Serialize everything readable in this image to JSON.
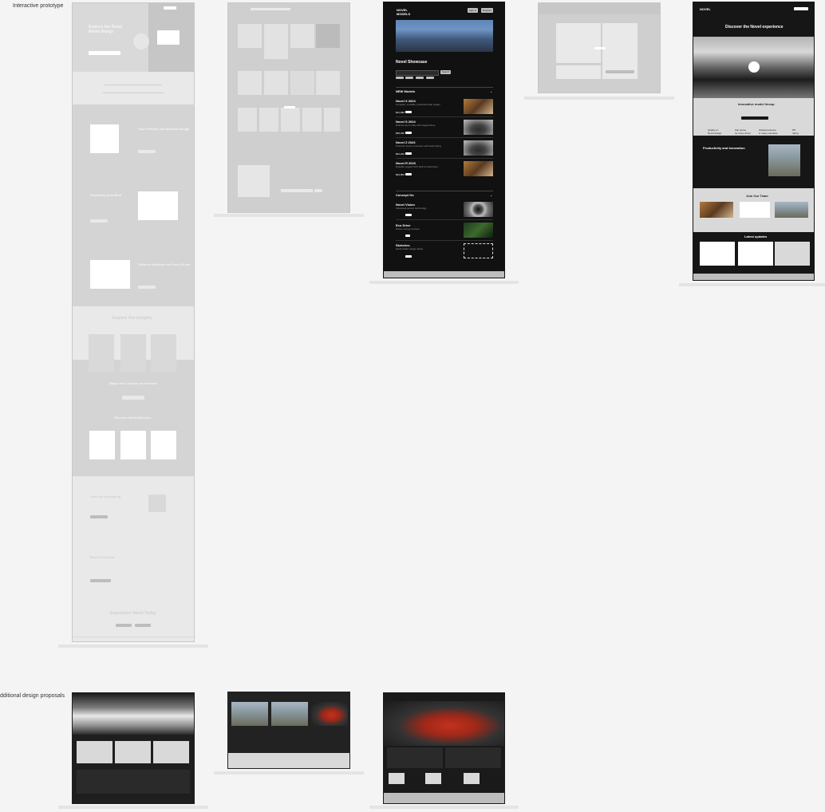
{
  "labels": {
    "interactive": "Interactive prototype",
    "additional": "dditional design proposals"
  },
  "f1": {
    "hero_title": "Explore the Novel\nModel Range",
    "section_title": "Your Friendly and Intuitive Design",
    "section2": "Simplicity at its Best",
    "section3": "Tailored Solutions for Every Driver",
    "insights": "Explore Our Insights",
    "journey": "Begin Your Journey to Success",
    "discover": "Discover Novel Services",
    "findOut": "Find Out Everything",
    "reachOut": "Reach Out Now!",
    "exp": "Experience Novel Today"
  },
  "f3": {
    "brand": "NOVEL\nMODELS",
    "btn1": "Sign in",
    "btn2": "Register",
    "showcase": "Novel Showcase",
    "filter_btn": "Search",
    "list_header": "NEW Models",
    "items": [
      {
        "title": "Novel X 2024",
        "desc": "Compact, versatile, practical urban design",
        "price": "$42,990"
      },
      {
        "title": "Novel S 2024",
        "desc": "Refined sport utility with elegant lines",
        "price": "$58,450"
      },
      {
        "title": "Novel Z 2023",
        "desc": "Premium luxury crossover with bold styling",
        "price": "$64,200"
      },
      {
        "title": "Novel R 2023",
        "desc": "Reliable rugged SUV built for adventure",
        "price": "$49,800"
      }
    ],
    "concept": "Concept Go",
    "concepts": [
      {
        "title": "Novel Vision",
        "desc": "Advanced sensor technology"
      },
      {
        "title": "Eco Drive",
        "desc": "Green energy concept"
      },
      {
        "title": "Sketches",
        "desc": "Hand-drawn design ideas"
      }
    ]
  },
  "f5": {
    "logo": "NOVEL",
    "discover": "Discover the Novel experience",
    "sub": "Innovative model lineup",
    "stats": [
      {
        "n": "Quality of",
        "d": "Novel design"
      },
      {
        "n": "Fair prices",
        "d": "for every driver"
      },
      {
        "n": "Global presence",
        "d": "in many countries"
      },
      {
        "n": "5/5",
        "d": "rating"
      }
    ],
    "section": "Productivity and Innovation",
    "team": "Join Our Team",
    "latest": "Latest updates"
  }
}
